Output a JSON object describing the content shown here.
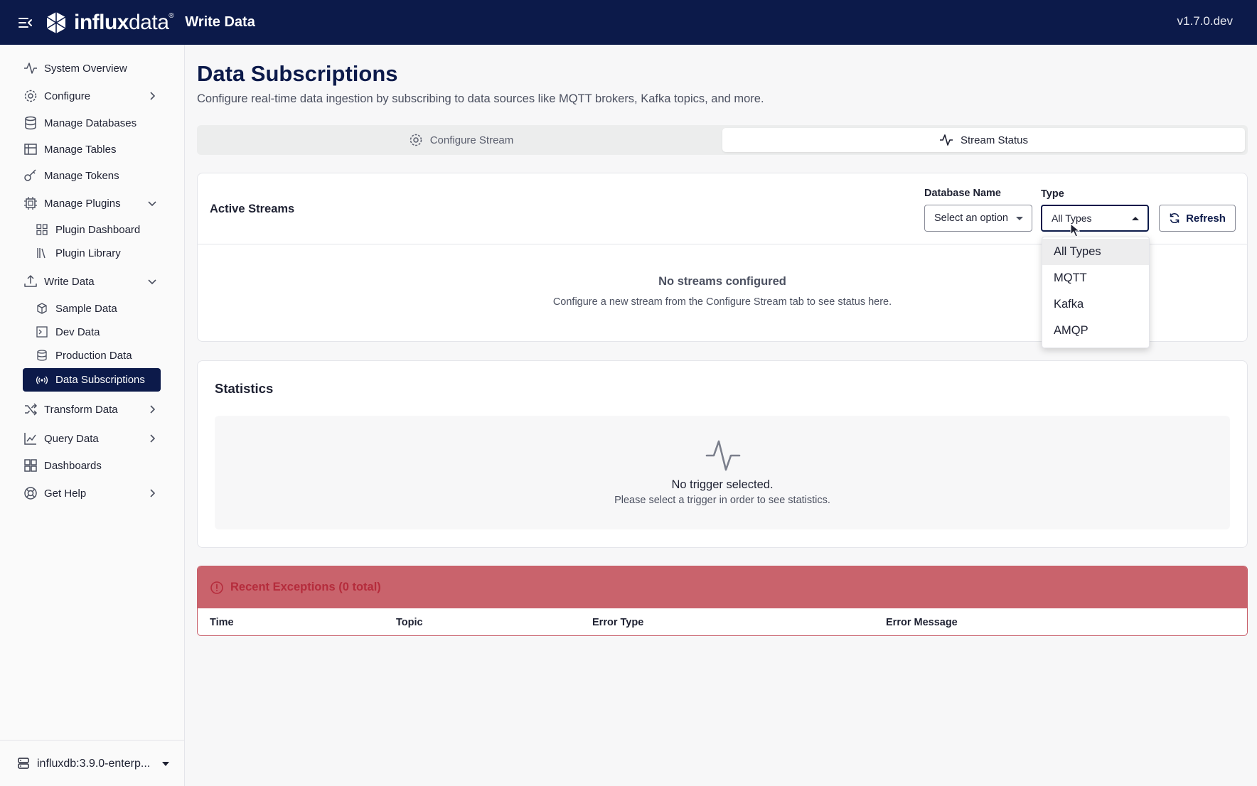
{
  "header": {
    "logo_bold": "influx",
    "logo_light": "data",
    "logo_mark": "®",
    "section_title": "Write Data",
    "version": "v1.7.0.dev"
  },
  "sidebar": {
    "items": [
      {
        "label": "System Overview",
        "icon": "activity-icon"
      },
      {
        "label": "Configure",
        "icon": "gear-icon"
      },
      {
        "label": "Manage Databases",
        "icon": "database-icon"
      },
      {
        "label": "Manage Tables",
        "icon": "table-icon"
      },
      {
        "label": "Manage Tokens",
        "icon": "key-icon"
      },
      {
        "label": "Manage Plugins",
        "icon": "chip-icon"
      },
      {
        "label": "Plugin Dashboard",
        "icon": "grid-icon"
      },
      {
        "label": "Plugin Library",
        "icon": "library-icon"
      },
      {
        "label": "Write Data",
        "icon": "upload-icon"
      },
      {
        "label": "Sample Data",
        "icon": "box-icon"
      },
      {
        "label": "Dev Data",
        "icon": "terminal-icon"
      },
      {
        "label": "Production Data",
        "icon": "database-icon"
      },
      {
        "label": "Data Subscriptions",
        "icon": "broadcast-icon"
      },
      {
        "label": "Transform Data",
        "icon": "shuffle-icon"
      },
      {
        "label": "Query Data",
        "icon": "chart-icon"
      },
      {
        "label": "Dashboards",
        "icon": "dashboard-icon"
      },
      {
        "label": "Get Help",
        "icon": "lifebuoy-icon"
      }
    ],
    "server": "influxdb:3.9.0-enterp..."
  },
  "main": {
    "title": "Data Subscriptions",
    "subtitle": "Configure real-time data ingestion by subscribing to data sources like MQTT brokers, Kafka topics, and more.",
    "tabs": [
      {
        "label": "Configure Stream",
        "active": false
      },
      {
        "label": "Stream Status",
        "active": true
      }
    ],
    "streams": {
      "title": "Active Streams",
      "db_label": "Database Name",
      "db_placeholder": "Select an option",
      "type_label": "Type",
      "type_value": "All Types",
      "refresh_label": "Refresh",
      "empty_title": "No streams configured",
      "empty_sub": "Configure a new stream from the Configure Stream tab to see status here."
    },
    "statistics": {
      "title": "Statistics",
      "empty_title": "No trigger selected.",
      "empty_sub": "Please select a trigger in order to see statistics."
    },
    "exceptions": {
      "title": "Recent Exceptions (0 total)",
      "columns": [
        "Time",
        "Topic",
        "Error Type",
        "Error Message"
      ]
    },
    "type_dropdown": {
      "options": [
        "All Types",
        "MQTT",
        "Kafka",
        "AMQP"
      ],
      "selected": "All Types"
    }
  },
  "colors": {
    "navy": "#0c1a4a",
    "error_bg": "#c9636c",
    "error_text": "#b52c3c"
  }
}
